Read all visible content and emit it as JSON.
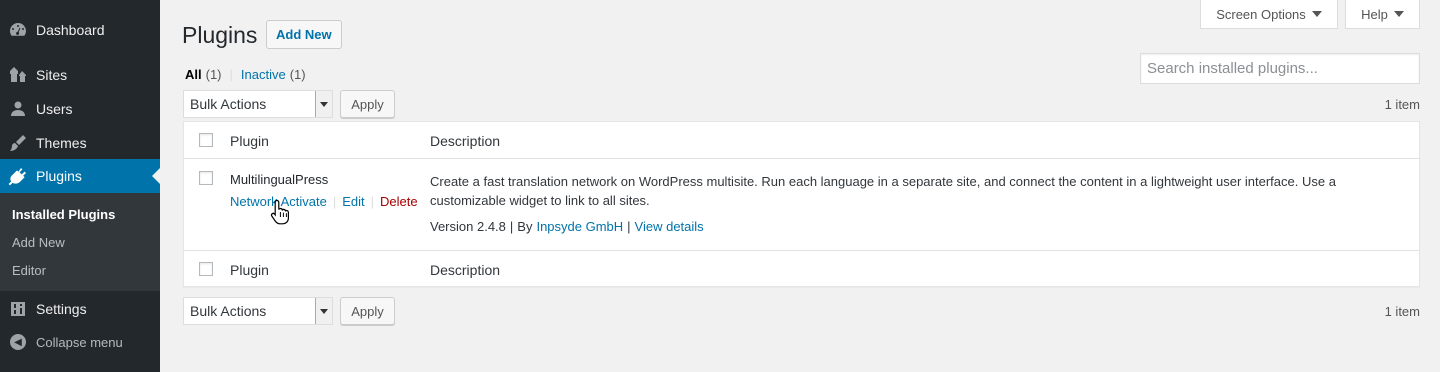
{
  "sidebar": {
    "items": [
      {
        "label": "Dashboard",
        "icon": "dashboard-icon"
      },
      {
        "label": "Sites",
        "icon": "sites-icon"
      },
      {
        "label": "Users",
        "icon": "users-icon"
      },
      {
        "label": "Themes",
        "icon": "themes-icon"
      },
      {
        "label": "Plugins",
        "icon": "plugins-icon",
        "current": true
      },
      {
        "label": "Settings",
        "icon": "settings-icon"
      }
    ],
    "submenu": [
      {
        "label": "Installed Plugins",
        "current": true
      },
      {
        "label": "Add New"
      },
      {
        "label": "Editor"
      }
    ],
    "collapse_label": "Collapse menu"
  },
  "header": {
    "screen_options": "Screen Options",
    "help": "Help",
    "title": "Plugins",
    "add_new": "Add New"
  },
  "filters": {
    "all_label": "All",
    "all_count": "(1)",
    "separator": "|",
    "inactive_label": "Inactive",
    "inactive_count": "(1)"
  },
  "search": {
    "placeholder": "Search installed plugins..."
  },
  "bulk": {
    "label": "Bulk Actions",
    "apply": "Apply",
    "items_count": "1 item"
  },
  "table": {
    "headers": {
      "plugin": "Plugin",
      "description": "Description"
    },
    "plugin": {
      "name": "MultilingualPress",
      "actions": {
        "network_activate": "Network Activate",
        "edit": "Edit",
        "delete": "Delete",
        "sep": "|"
      },
      "description": "Create a fast translation network on WordPress multisite. Run each language in a separate site, and connect the content in a lightweight user interface. Use a customizable widget to link to all sites.",
      "version": "Version 2.4.8",
      "by": "By",
      "author": "Inpsyde GmbH",
      "view_details": "View details",
      "sep": "|"
    }
  },
  "colors": {
    "sidebar_bg": "#23282d",
    "accent": "#0073aa",
    "delete": "#aa0000",
    "page_bg": "#f1f1f1"
  }
}
